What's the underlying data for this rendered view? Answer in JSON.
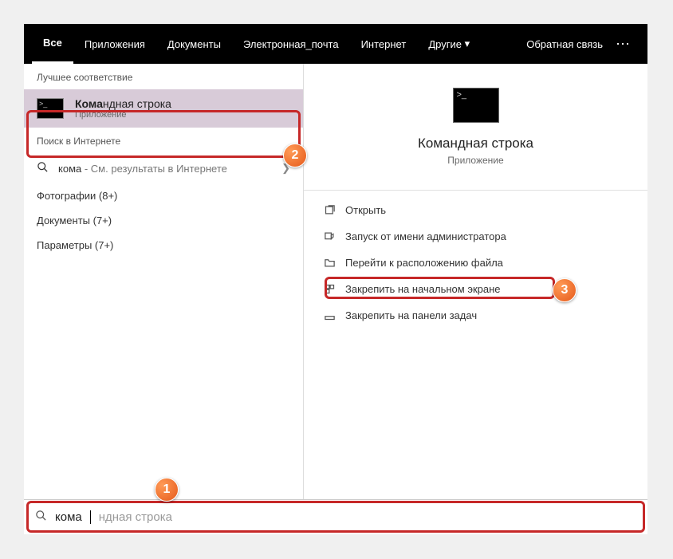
{
  "tabs": {
    "all": "Все",
    "apps": "Приложения",
    "docs": "Документы",
    "email": "Электронная_почта",
    "internet": "Интернет",
    "other": "Другие",
    "feedback": "Обратная связь"
  },
  "left": {
    "best_match": "Лучшее соответствие",
    "result_title_match": "Кома",
    "result_title_rest": "ндная строка",
    "result_sub": "Приложение",
    "web_head": "Поиск в Интернете",
    "web_query": "кома",
    "web_hint": " - См. результаты в Интернете",
    "photos": "Фотографии (8+)",
    "documents": "Документы (7+)",
    "settings": "Параметры (7+)"
  },
  "right": {
    "title": "Командная строка",
    "sub": "Приложение",
    "open": "Открыть",
    "run_admin": "Запуск от имени администратора",
    "open_location": "Перейти к расположению файла",
    "pin_start": "Закрепить на начальном экране",
    "pin_taskbar": "Закрепить на панели задач"
  },
  "search": {
    "typed": "кома",
    "ghost": "ндная строка"
  },
  "badges": {
    "b1": "1",
    "b2": "2",
    "b3": "3"
  }
}
